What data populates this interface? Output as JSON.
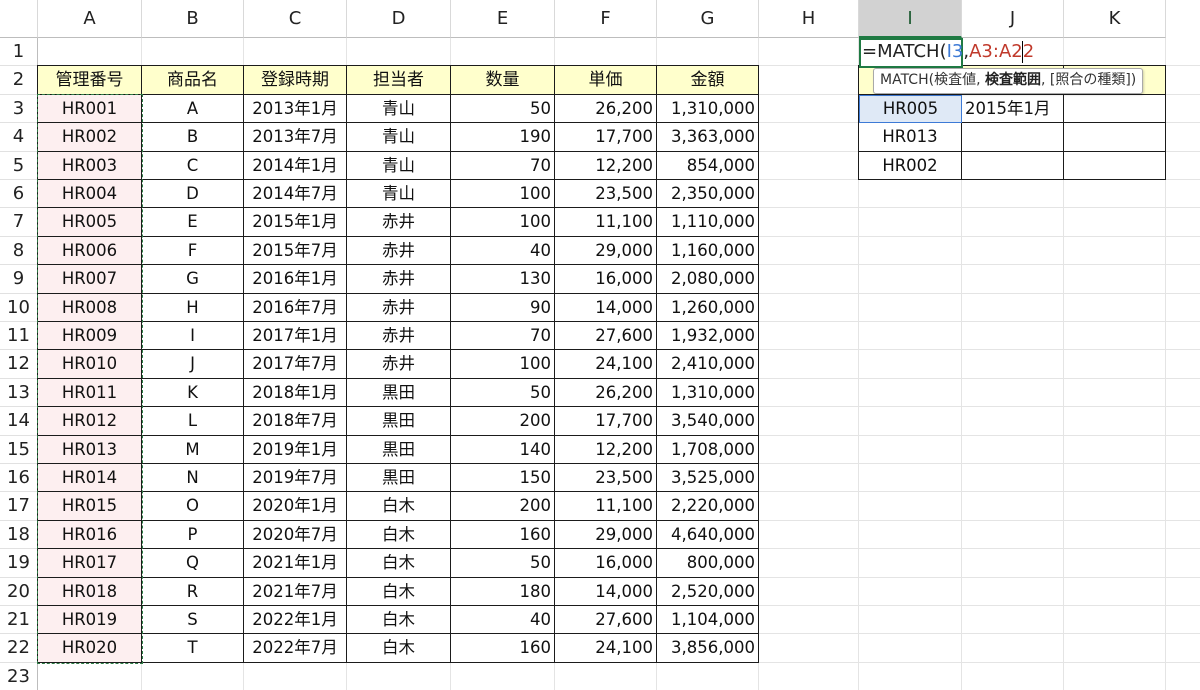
{
  "columns": [
    "A",
    "B",
    "C",
    "D",
    "E",
    "F",
    "G",
    "H",
    "I",
    "J",
    "K"
  ],
  "active_column": "I",
  "rows": [
    "1",
    "2",
    "3",
    "4",
    "5",
    "6",
    "7",
    "8",
    "9",
    "10",
    "11",
    "12",
    "13",
    "14",
    "15",
    "16",
    "17",
    "18",
    "19",
    "20",
    "21",
    "22",
    "23"
  ],
  "table": {
    "headers": [
      "管理番号",
      "商品名",
      "登録時期",
      "担当者",
      "数量",
      "単価",
      "金額"
    ],
    "rows": [
      [
        "HR001",
        "A",
        "2013年1月",
        "青山",
        "50",
        "26,200",
        "1,310,000"
      ],
      [
        "HR002",
        "B",
        "2013年7月",
        "青山",
        "190",
        "17,700",
        "3,363,000"
      ],
      [
        "HR003",
        "C",
        "2014年1月",
        "青山",
        "70",
        "12,200",
        "854,000"
      ],
      [
        "HR004",
        "D",
        "2014年7月",
        "青山",
        "100",
        "23,500",
        "2,350,000"
      ],
      [
        "HR005",
        "E",
        "2015年1月",
        "赤井",
        "100",
        "11,100",
        "1,110,000"
      ],
      [
        "HR006",
        "F",
        "2015年7月",
        "赤井",
        "40",
        "29,000",
        "1,160,000"
      ],
      [
        "HR007",
        "G",
        "2016年1月",
        "赤井",
        "130",
        "16,000",
        "2,080,000"
      ],
      [
        "HR008",
        "H",
        "2016年7月",
        "赤井",
        "90",
        "14,000",
        "1,260,000"
      ],
      [
        "HR009",
        "I",
        "2017年1月",
        "赤井",
        "70",
        "27,600",
        "1,932,000"
      ],
      [
        "HR010",
        "J",
        "2017年7月",
        "赤井",
        "100",
        "24,100",
        "2,410,000"
      ],
      [
        "HR011",
        "K",
        "2018年1月",
        "黒田",
        "50",
        "26,200",
        "1,310,000"
      ],
      [
        "HR012",
        "L",
        "2018年7月",
        "黒田",
        "200",
        "17,700",
        "3,540,000"
      ],
      [
        "HR013",
        "M",
        "2019年1月",
        "黒田",
        "140",
        "12,200",
        "1,708,000"
      ],
      [
        "HR014",
        "N",
        "2019年7月",
        "黒田",
        "150",
        "23,500",
        "3,525,000"
      ],
      [
        "HR015",
        "O",
        "2020年1月",
        "白木",
        "200",
        "11,100",
        "2,220,000"
      ],
      [
        "HR016",
        "P",
        "2020年7月",
        "白木",
        "160",
        "29,000",
        "4,640,000"
      ],
      [
        "HR017",
        "Q",
        "2021年1月",
        "白木",
        "50",
        "16,000",
        "800,000"
      ],
      [
        "HR018",
        "R",
        "2021年7月",
        "白木",
        "180",
        "14,000",
        "2,520,000"
      ],
      [
        "HR019",
        "S",
        "2022年1月",
        "白木",
        "40",
        "27,600",
        "1,104,000"
      ],
      [
        "HR020",
        "T",
        "2022年7月",
        "白木",
        "160",
        "24,100",
        "3,856,000"
      ]
    ]
  },
  "formula": {
    "prefix": "=MATCH(",
    "arg1": "I3",
    "separator": ",",
    "arg2": "A3:A22"
  },
  "tooltip": {
    "func": "MATCH(",
    "param1": "検査値, ",
    "param2": "検査範囲",
    "param3": ", [照合の種類])"
  },
  "lookup": {
    "rows": [
      [
        "HR005",
        "2015年1月",
        ""
      ],
      [
        "HR013",
        "",
        ""
      ],
      [
        "HR002",
        "",
        ""
      ]
    ]
  },
  "colors": {
    "header_fill": "#ffffcc",
    "key_column_fill": "#fdeff0",
    "marquee": "#2e7d46",
    "ref_blue": "#3d7ad6",
    "ref_red": "#c0392b"
  }
}
